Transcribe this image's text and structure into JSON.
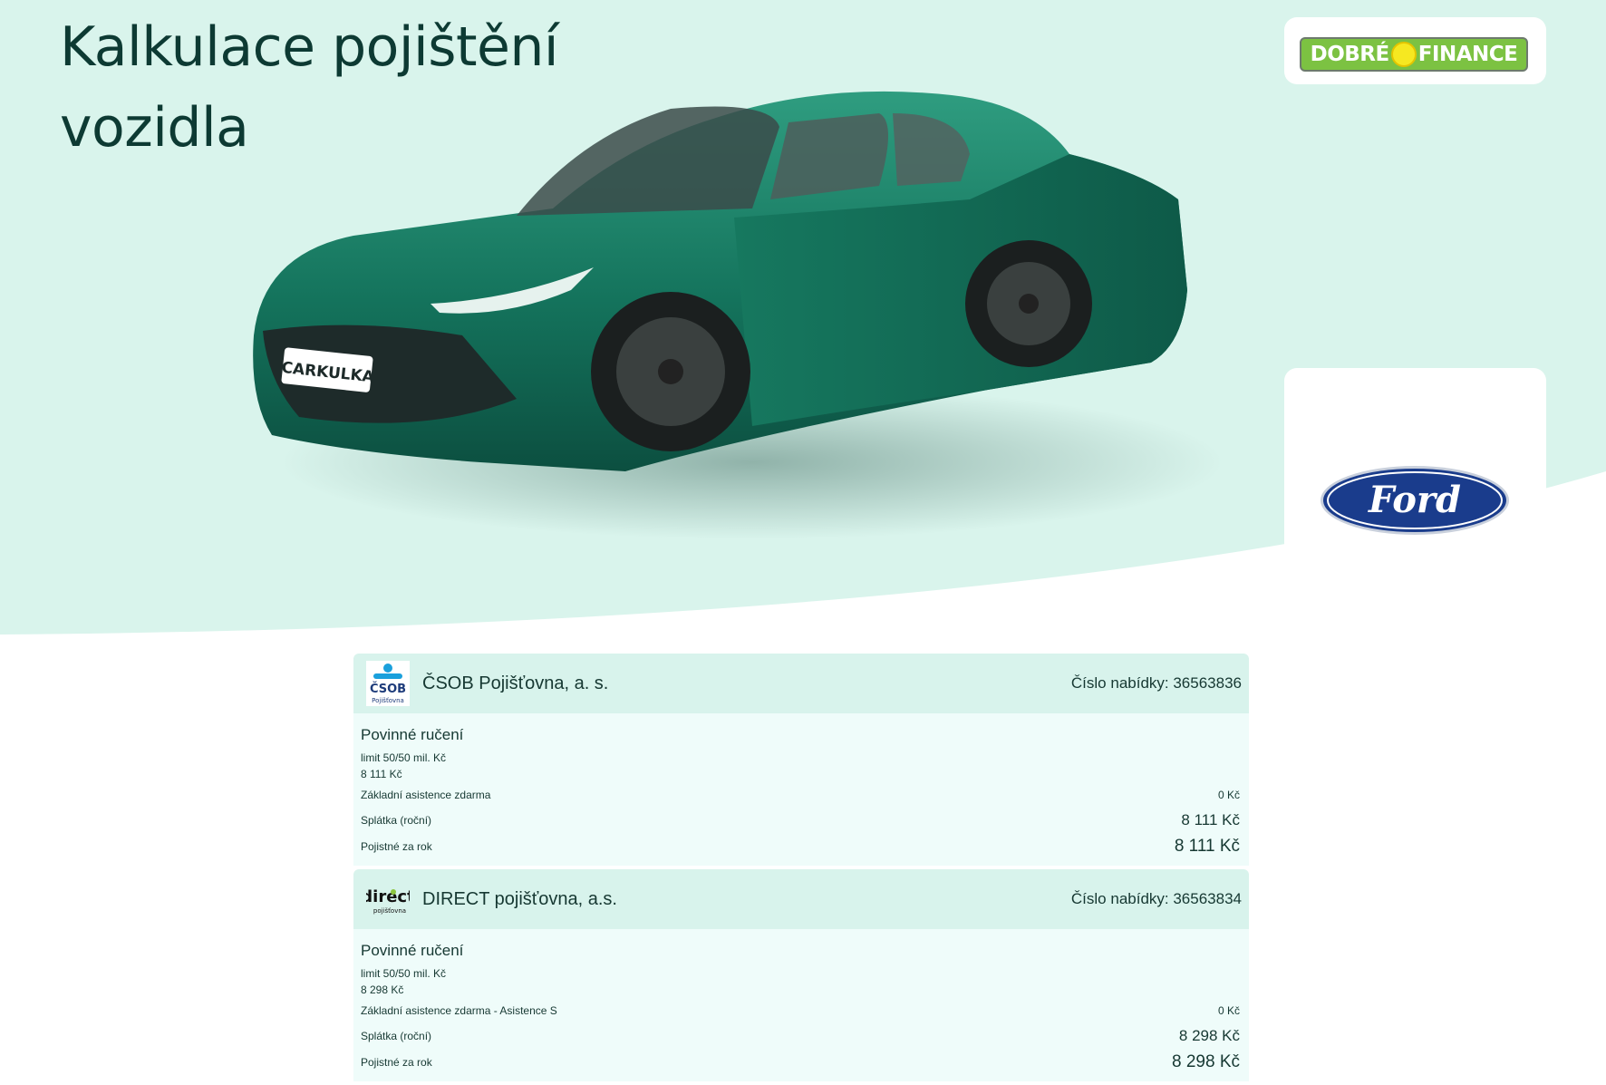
{
  "page": {
    "title": "Kalkulace pojištění vozidla",
    "colors": {
      "hero_bg": "#d9f4ec",
      "accent": "#0d3a33",
      "row_header": "#d8f3ec",
      "row_body": "#effcfa"
    }
  },
  "partner_logo": {
    "text_left": "DOBRÉ",
    "text_right": "FINANCE"
  },
  "brand_logo": {
    "name": "Ford"
  },
  "car_image": {
    "plate": "CARKULKA"
  },
  "offers": [
    {
      "insurer": "ČSOB Pojišťovna, a. s.",
      "logo_icon": "csob-logo-icon",
      "offer_number": "Číslo nabídky: 36563836",
      "coverage_title": "Povinné ručení",
      "limit": "limit 50/50 mil. Kč",
      "coverage_price": "8 111 Kč",
      "assistance_label": "Základní asistence zdarma",
      "assistance_price": "0 Kč",
      "installment_label": "Splátka (roční)",
      "installment_value": "8 111 Kč",
      "annual_label": "Pojistné za rok",
      "annual_value": "8 111 Kč"
    },
    {
      "insurer": "DIRECT pojišťovna, a.s.",
      "logo_icon": "direct-logo-icon",
      "offer_number": "Číslo nabídky: 36563834",
      "coverage_title": "Povinné ručení",
      "limit": "limit 50/50 mil. Kč",
      "coverage_price": "8 298 Kč",
      "assistance_label": "Základní asistence zdarma - Asistence S",
      "assistance_price": "0 Kč",
      "installment_label": "Splátka (roční)",
      "installment_value": "8 298 Kč",
      "annual_label": "Pojistné za rok",
      "annual_value": "8 298 Kč"
    }
  ]
}
